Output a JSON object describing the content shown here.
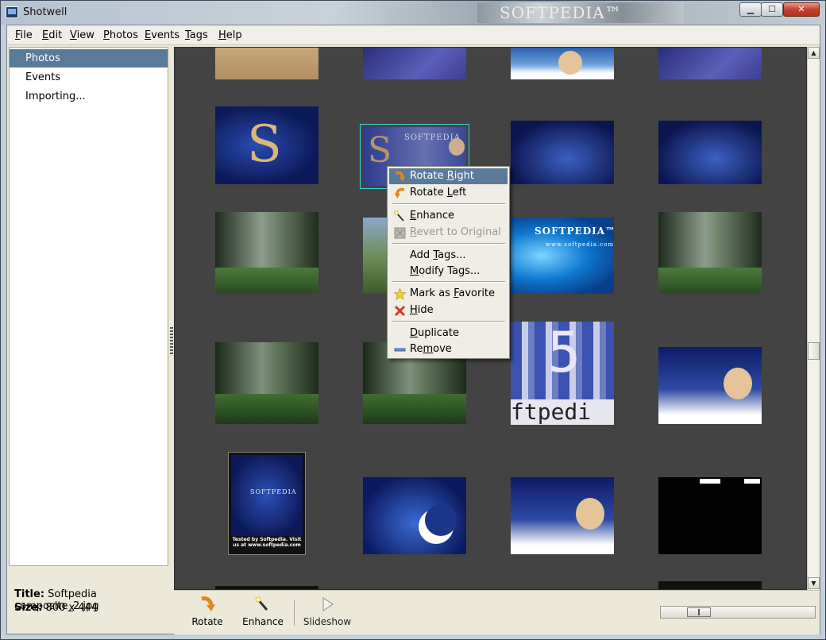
{
  "window": {
    "title": "Shotwell",
    "watermark": "SOFTPEDIA™"
  },
  "window_controls": {
    "minimize": "▁",
    "maximize": "☐",
    "close": "✕"
  },
  "menu": [
    {
      "label": "File",
      "ul": "F",
      "rest": "ile"
    },
    {
      "label": "Edit",
      "ul": "E",
      "rest": "dit"
    },
    {
      "label": "View",
      "ul": "V",
      "rest": "iew"
    },
    {
      "label": "Photos",
      "ul": "P",
      "rest": "hotos"
    },
    {
      "label": "Events",
      "ul": "E",
      "rest": "vents"
    },
    {
      "label": "Tags",
      "ul": "T",
      "rest": "ags"
    },
    {
      "label": "Help",
      "ul": "H",
      "rest": "elp"
    }
  ],
  "sidebar": {
    "items": [
      {
        "label": "Photos",
        "selected": true
      },
      {
        "label": "Events",
        "selected": false
      },
      {
        "label": "Importing...",
        "selected": false
      }
    ]
  },
  "info": {
    "title_label": "Title:",
    "title_value": "Softpedia composite_2.jpg",
    "size_label": "Size:",
    "size_value": "800 x 444"
  },
  "thumbnails": {
    "softpedia_text": "SOFTPEDIA™",
    "softpedia_url": "www.softpedia.com",
    "softpedia_small": "SOFTPEDIA",
    "tested_text": "Tested by Softpedia. Visit us at www.softpedia.com",
    "pixel_text_1": "5",
    "pixel_text_2": "ftpedi"
  },
  "toolbar": {
    "rotate": "Rotate",
    "enhance": "Enhance",
    "slideshow": "Slideshow"
  },
  "zoom": {
    "level": 0.2
  },
  "context_menu": [
    {
      "pre": "Rotate ",
      "ul": "R",
      "post": "ight",
      "icon": "rotate-right-icon",
      "selected": true,
      "disabled": false
    },
    {
      "pre": "Rotate ",
      "ul": "L",
      "post": "eft",
      "icon": "rotate-left-icon",
      "selected": false,
      "disabled": false
    },
    {
      "pre": "",
      "ul": "E",
      "post": "nhance",
      "icon": "enhance-icon",
      "selected": false,
      "disabled": false
    },
    {
      "pre": "",
      "ul": "R",
      "post": "evert to Original",
      "icon": "revert-icon",
      "selected": false,
      "disabled": true
    },
    {
      "pre": "Add ",
      "ul": "T",
      "post": "ags...",
      "icon": "",
      "selected": false,
      "disabled": false
    },
    {
      "pre": "",
      "ul": "M",
      "post": "odify Tags...",
      "icon": "",
      "selected": false,
      "disabled": false
    },
    {
      "pre": "Mark as ",
      "ul": "F",
      "post": "avorite",
      "icon": "star-icon",
      "selected": false,
      "disabled": false
    },
    {
      "pre": "",
      "ul": "H",
      "post": "ide",
      "icon": "hide-icon",
      "selected": false,
      "disabled": false
    },
    {
      "pre": "",
      "ul": "D",
      "post": "uplicate",
      "icon": "",
      "selected": false,
      "disabled": false
    },
    {
      "pre": "Re",
      "ul": "m",
      "post": "ove",
      "icon": "remove-icon",
      "selected": false,
      "disabled": false
    }
  ],
  "colors": {
    "selection": "#5a7a9a",
    "content_bg": "#434343",
    "hide_red": "#d83a2a",
    "rotate_orange": "#e0861c",
    "star_yellow": "#f5d42a"
  }
}
